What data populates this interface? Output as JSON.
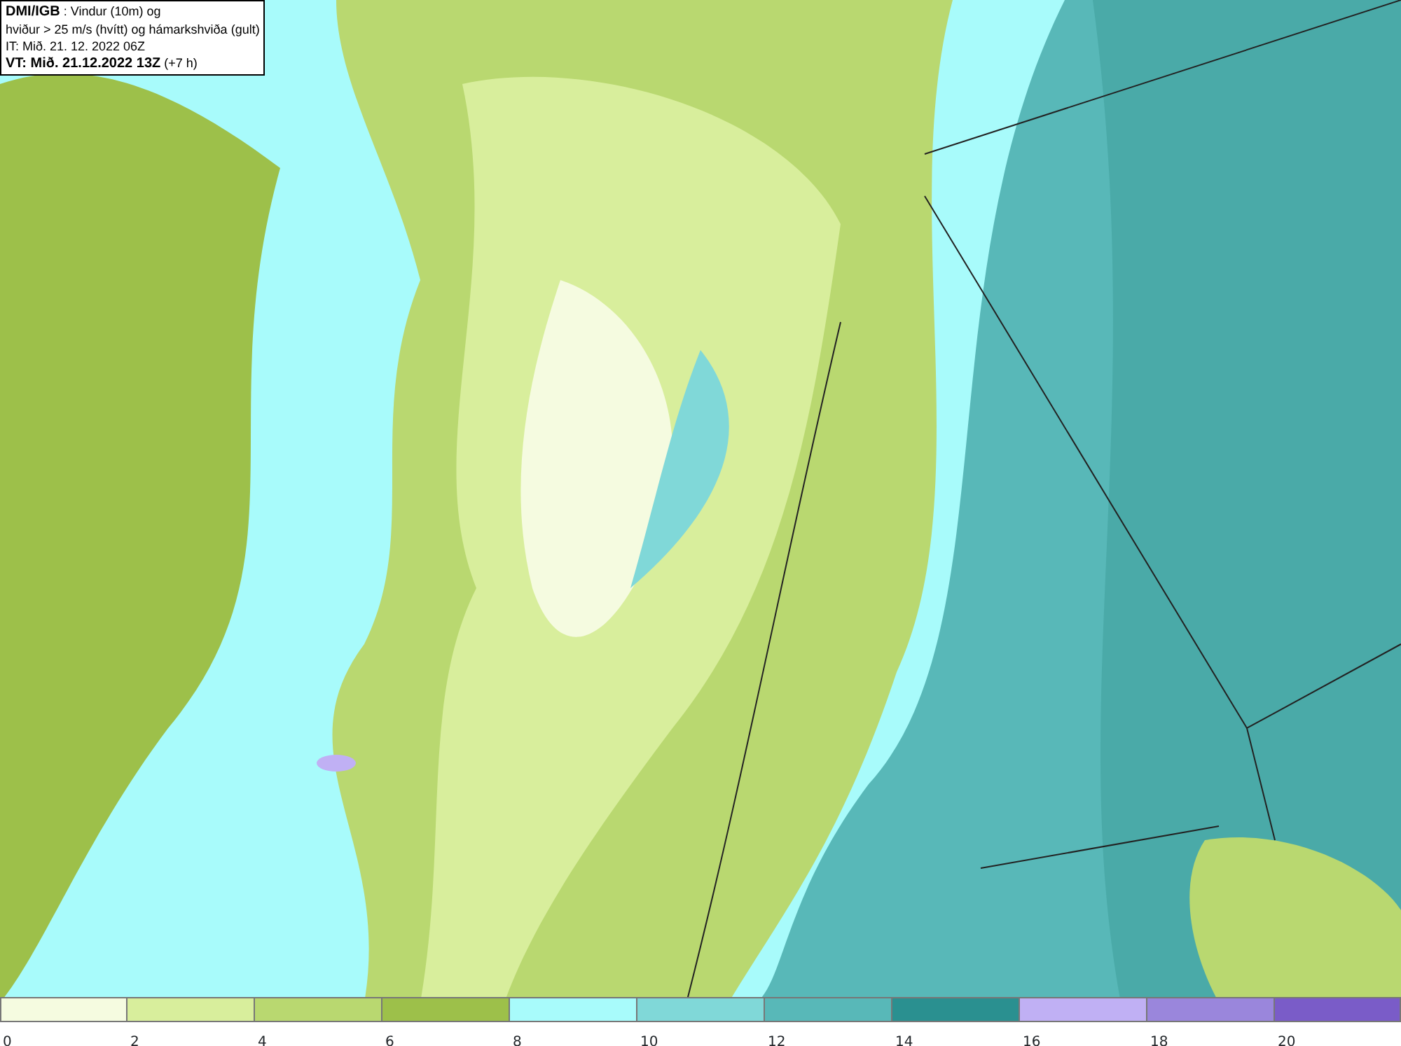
{
  "header": {
    "lines": [
      "**DMI/IGB** : Vindur (10m) og",
      "hviður > 25 m/s (hvítt) og hámarkshviða (gult)",
      "IT: Mið. 21. 12. 2022 06Z",
      "**VT: Mið. 21.12.2022 13Z** (+7 h)"
    ]
  },
  "legend": {
    "bins": [
      {
        "label": "0",
        "color": "#f5fbe0"
      },
      {
        "label": "2",
        "color": "#d8ee9c"
      },
      {
        "label": "4",
        "color": "#b9d870"
      },
      {
        "label": "6",
        "color": "#9dc04a"
      },
      {
        "label": "8",
        "color": "#a8fbfb"
      },
      {
        "label": "10",
        "color": "#80d8d8"
      },
      {
        "label": "12",
        "color": "#58b8b8"
      },
      {
        "label": "14",
        "color": "#2a9090"
      },
      {
        "label": "16",
        "color": "#c0b0f4"
      },
      {
        "label": "18",
        "color": "#9a86dc"
      },
      {
        "label": "20",
        "color": "#7a5cc8"
      }
    ]
  }
}
